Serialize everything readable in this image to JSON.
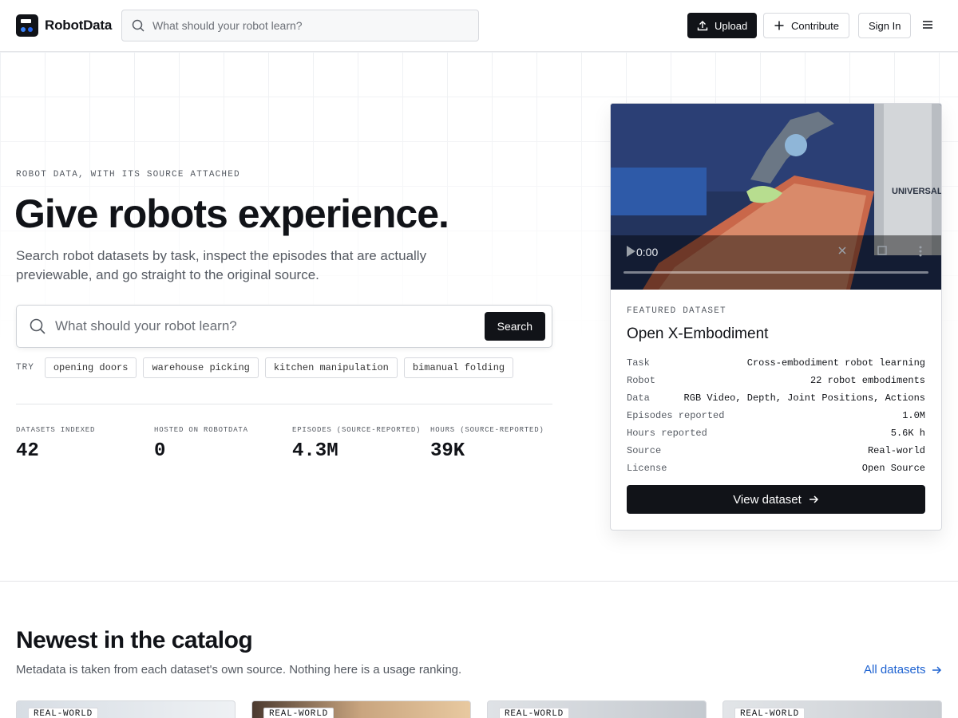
{
  "header": {
    "logo_text": "RobotData",
    "search_placeholder": "What should your robot learn?",
    "upload_label": "Upload",
    "contribute_label": "Contribute",
    "signin_label": "Sign In"
  },
  "hero": {
    "eyebrow": "ROBOT DATA, WITH ITS SOURCE ATTACHED",
    "title": "Give robots experience.",
    "subtitle": "Search robot datasets by task, inspect the episodes that are actually previewable, and go straight to the original source.",
    "search_placeholder": "What should your robot learn?",
    "search_button": "Search",
    "try_label": "TRY",
    "suggestions": [
      "opening doors",
      "warehouse picking",
      "kitchen manipulation",
      "bimanual folding"
    ],
    "stats": [
      {
        "label": "DATASETS INDEXED",
        "value": "42"
      },
      {
        "label": "HOSTED ON ROBOTDATA",
        "value": "0"
      },
      {
        "label": "EPISODES (SOURCE-REPORTED)",
        "value": "4.3M"
      },
      {
        "label": "HOURS (SOURCE-REPORTED)",
        "value": "39K"
      }
    ]
  },
  "featured": {
    "video_time": "0:00",
    "video_brand": "UNIVERSAL",
    "eyebrow": "FEATURED DATASET",
    "title": "Open X-Embodiment",
    "meta": [
      {
        "key": "Task",
        "value": "Cross-embodiment robot learning"
      },
      {
        "key": "Robot",
        "value": "22 robot embodiments"
      },
      {
        "key": "Data",
        "value": "RGB Video, Depth, Joint Positions, Actions"
      },
      {
        "key": "Episodes reported",
        "value": "1.0M"
      },
      {
        "key": "Hours reported",
        "value": "5.6K h"
      },
      {
        "key": "Source",
        "value": "Real-world"
      },
      {
        "key": "License",
        "value": "Open Source"
      }
    ],
    "view_label": "View dataset"
  },
  "catalog": {
    "title": "Newest in the catalog",
    "subtitle": "Metadata is taken from each dataset's own source. Nothing here is a usage ranking.",
    "all_link": "All datasets",
    "cards": [
      {
        "badge": "REAL-WORLD"
      },
      {
        "badge": "REAL-WORLD"
      },
      {
        "badge": "REAL-WORLD"
      },
      {
        "badge": "REAL-WORLD"
      }
    ]
  },
  "colors": {
    "primary": "#111318",
    "link": "#1d62d1",
    "muted": "#555a62",
    "border": "#d7d9de"
  }
}
